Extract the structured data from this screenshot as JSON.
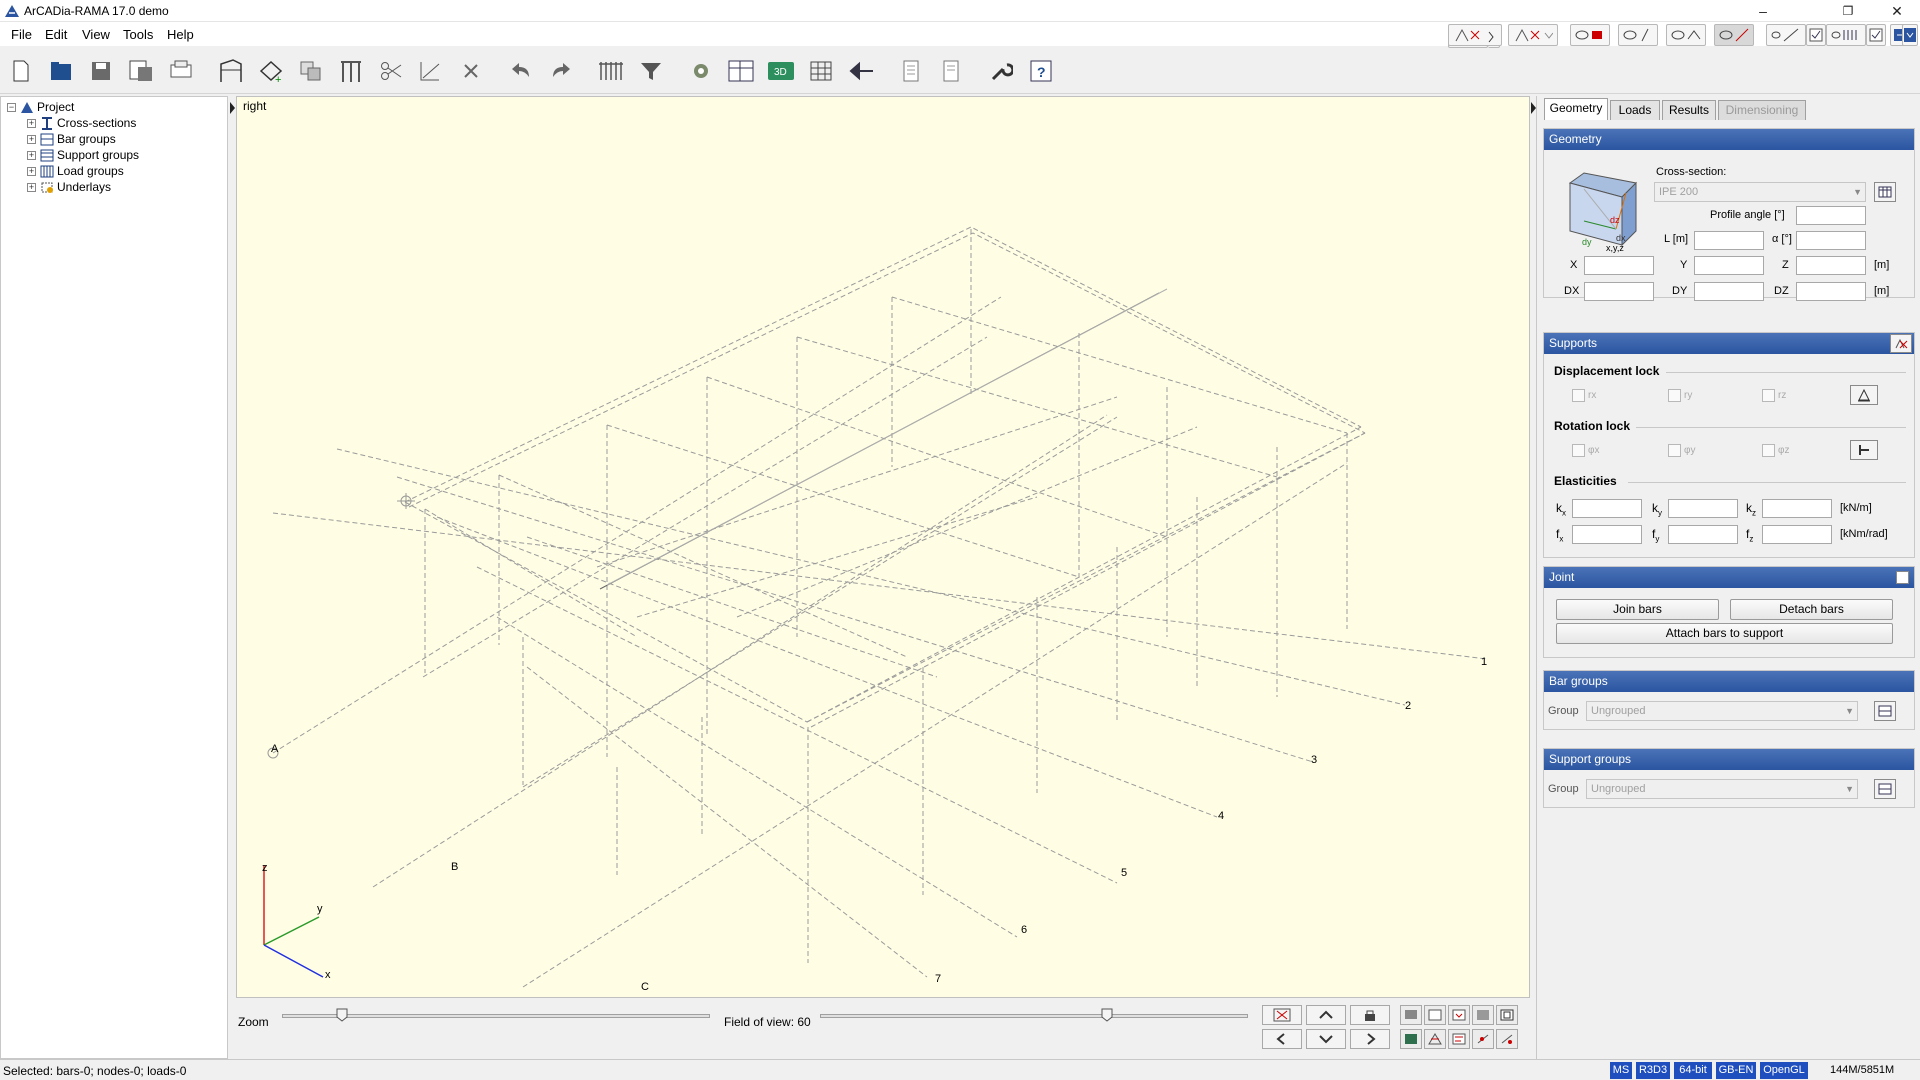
{
  "window": {
    "title": "ArCADia-RAMA 17.0 demo"
  },
  "menu": [
    "File",
    "Edit",
    "View",
    "Tools",
    "Help"
  ],
  "tree": {
    "root": "Project",
    "items": [
      "Cross-sections",
      "Bar groups",
      "Support groups",
      "Load groups",
      "Underlays"
    ]
  },
  "viewport": {
    "view_label": "right",
    "axis_labels": {
      "z": "z",
      "y": "y",
      "x": "x"
    },
    "grid_letters": [
      "A",
      "B",
      "C"
    ],
    "grid_numbers": [
      "1",
      "2",
      "3",
      "4",
      "5",
      "6",
      "7"
    ]
  },
  "bottom": {
    "zoom_label": "Zoom",
    "fov_label": "Field of view: 60",
    "zoom_value": 0.14,
    "fov_value": 0.67
  },
  "tabs": [
    {
      "label": "Geometry",
      "active": true
    },
    {
      "label": "Loads"
    },
    {
      "label": "Results"
    },
    {
      "label": "Dimensioning",
      "disabled": true
    }
  ],
  "geometry": {
    "title": "Geometry",
    "cross_section_label": "Cross-section:",
    "cross_section_value": "IPE 200",
    "profile_angle_label": "Profile angle [°]",
    "l_label": "L [m]",
    "alpha_label": "α [°]",
    "x_label": "X",
    "y_label": "Y",
    "z_label": "Z",
    "m1": "[m]",
    "dx_label": "DX",
    "dy_label": "DY",
    "dz_label": "DZ",
    "m2": "[m]",
    "preview_labels": {
      "dz": "dz",
      "dx": "dx",
      "dy": "dy",
      "xyz": "x,y,z"
    }
  },
  "supports": {
    "title": "Supports",
    "displacement_lock": "Displacement lock",
    "disp_items": [
      "rx",
      "ry",
      "rz"
    ],
    "rotation_lock": "Rotation lock",
    "rot_items": [
      "φx",
      "φy",
      "φz"
    ],
    "elasticities": "Elasticities",
    "k_labels": [
      "k",
      "k",
      "k"
    ],
    "k_subs": [
      "x",
      "y",
      "z"
    ],
    "k_unit": "[kN/m]",
    "f_labels": [
      "f",
      "f",
      "f"
    ],
    "f_subs": [
      "x",
      "y",
      "z"
    ],
    "f_unit": "[kNm/rad]"
  },
  "joint": {
    "title": "Joint",
    "join": "Join bars",
    "detach": "Detach bars",
    "attach": "Attach bars to support"
  },
  "bar_groups": {
    "title": "Bar groups",
    "group_label": "Group",
    "group_value": "Ungrouped"
  },
  "support_groups": {
    "title": "Support groups",
    "group_label": "Group",
    "group_value": "Ungrouped"
  },
  "status": {
    "text": "Selected: bars-0; nodes-0; loads-0",
    "badges": [
      "MS",
      "R3D3",
      "64-bit",
      "GB-EN",
      "OpenGL"
    ],
    "memory": "144M/5851M"
  },
  "colors": {
    "header": "#2b55a0",
    "viewport_bg": "#fffee5",
    "badge": "#1f4fbf"
  }
}
